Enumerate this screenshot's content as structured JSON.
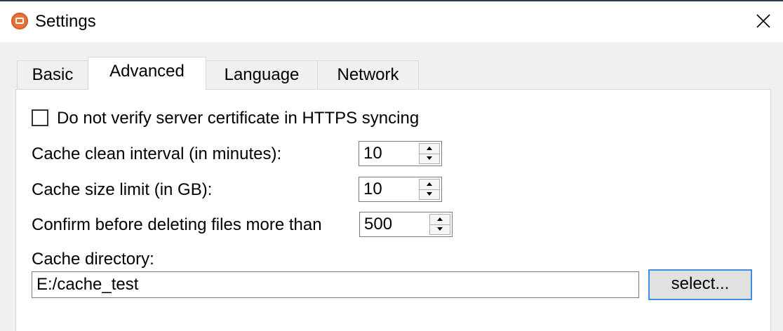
{
  "window": {
    "title": "Settings",
    "app_icon": "seafile-logo-icon",
    "close_icon": "close-icon"
  },
  "tabs": [
    {
      "label": "Basic",
      "active": false
    },
    {
      "label": "Advanced",
      "active": true
    },
    {
      "label": "Language",
      "active": false
    },
    {
      "label": "Network",
      "active": false
    }
  ],
  "advanced": {
    "verify_cert": {
      "label": "Do not verify server certificate in HTTPS syncing",
      "checked": false
    },
    "cache_clean_interval": {
      "label": "Cache clean interval (in minutes):",
      "value": "10"
    },
    "cache_size_limit": {
      "label": "Cache size limit (in GB):",
      "value": "10"
    },
    "confirm_delete": {
      "label": "Confirm before deleting files more than",
      "value": "500"
    },
    "cache_directory": {
      "label": "Cache directory:",
      "value": "E:/cache_test",
      "select_label": "select..."
    }
  },
  "colors": {
    "accent_border": "#3b8ee0",
    "titlebar_bg": "#ffffff",
    "window_bg": "#f0f0f0",
    "app_icon": "#e8733a"
  }
}
